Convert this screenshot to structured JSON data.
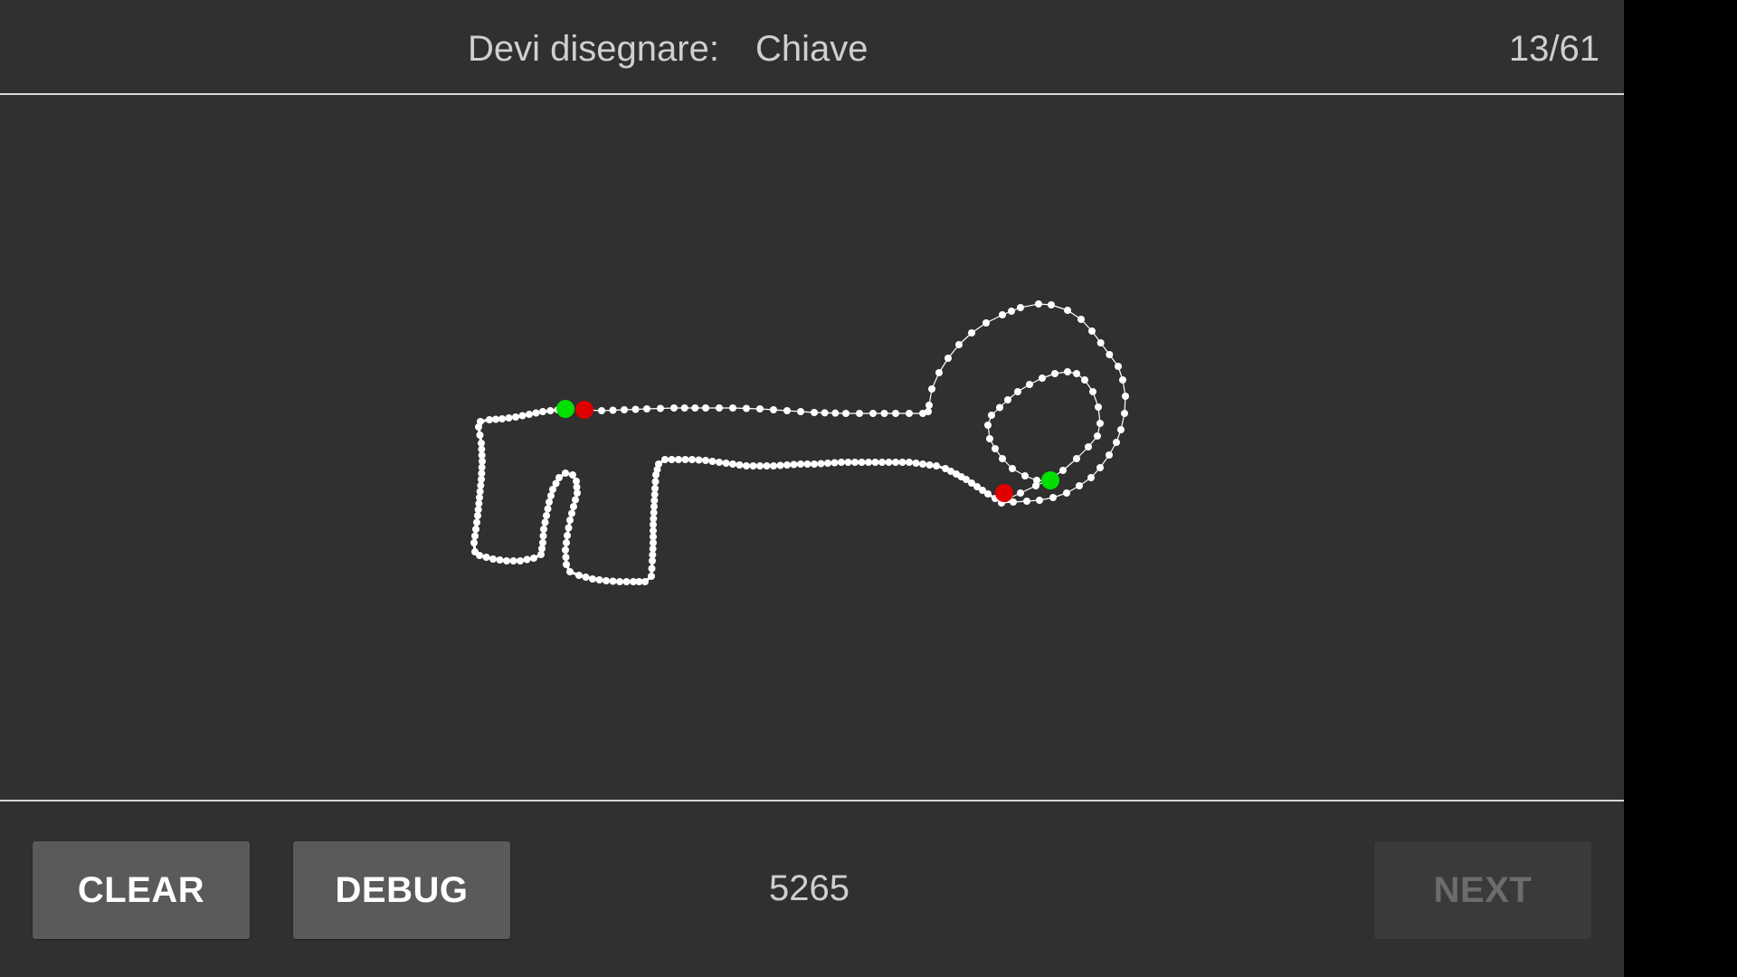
{
  "header": {
    "prompt_label": "Devi disegnare:",
    "prompt_word": "Chiave",
    "progress": "13/61"
  },
  "footer": {
    "clear_label": "CLEAR",
    "debug_label": "DEBUG",
    "score": "5265",
    "next_label": "NEXT",
    "next_enabled": false
  },
  "colors": {
    "background": "#303030",
    "stroke": "#ffffff",
    "start_marker": "#00e000",
    "end_marker": "#e00000",
    "divider": "#d8d8d8",
    "button": "#5a5a5c",
    "button_disabled": "#3a3a3a"
  }
}
